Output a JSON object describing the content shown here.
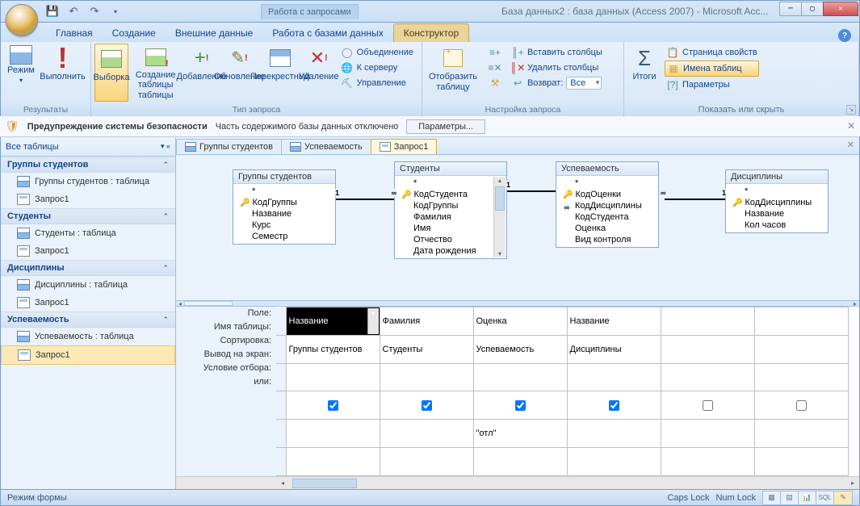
{
  "titlebar": {
    "context_tools": "Работа с запросами",
    "title": "База данных2 : база данных (Access 2007) - Microsoft Acc..."
  },
  "tabs": {
    "items": [
      "Главная",
      "Создание",
      "Внешние данные",
      "Работа с базами данных",
      "Конструктор"
    ],
    "active_index": 4
  },
  "ribbon": {
    "group_results": {
      "label": "Результаты",
      "mode": "Режим",
      "run": "Выполнить"
    },
    "group_querytype": {
      "label": "Тип запроса",
      "select": "Выборка",
      "maketable": "Создание таблицы",
      "append": "Добавление",
      "update": "Обновление",
      "crosstab": "Перекрестный",
      "delete": "Удаление",
      "union": "Объединение",
      "passthrough": "К серверу",
      "datadef": "Управление"
    },
    "group_querysetup": {
      "label": "Настройка запроса",
      "showtable": "Отобразить таблицу",
      "insert_cols": "Вставить столбцы",
      "delete_cols": "Удалить столбцы",
      "return_label": "Возврат:",
      "return_value": "Все"
    },
    "group_showhide": {
      "label": "Показать или скрыть",
      "totals": "Итоги",
      "prop_sheet": "Страница свойств",
      "table_names": "Имена таблиц",
      "parameters": "Параметры"
    }
  },
  "security": {
    "title": "Предупреждение системы безопасности",
    "msg": "Часть содержимого базы данных отключено",
    "btn": "Параметры..."
  },
  "nav": {
    "header": "Все таблицы",
    "groups": [
      {
        "title": "Группы студентов",
        "items": [
          {
            "type": "table",
            "label": "Группы студентов : таблица"
          },
          {
            "type": "query",
            "label": "Запрос1"
          }
        ]
      },
      {
        "title": "Студенты",
        "items": [
          {
            "type": "table",
            "label": "Студенты : таблица"
          },
          {
            "type": "query",
            "label": "Запрос1"
          }
        ]
      },
      {
        "title": "Дисциплины",
        "items": [
          {
            "type": "table",
            "label": "Дисциплины : таблица"
          },
          {
            "type": "query",
            "label": "Запрос1"
          }
        ]
      },
      {
        "title": "Успеваемость",
        "items": [
          {
            "type": "table",
            "label": "Успеваемость : таблица"
          },
          {
            "type": "query",
            "label": "Запрос1",
            "selected": true
          }
        ]
      }
    ]
  },
  "doc_tabs": [
    "Группы студентов",
    "Успеваемость",
    "Запрос1"
  ],
  "doc_tab_active": 2,
  "designer_tables": {
    "t1": {
      "title": "Группы студентов",
      "fields": [
        "*",
        "КодГруппы",
        "Название",
        "Курс",
        "Семестр"
      ],
      "key_index": 1
    },
    "t2": {
      "title": "Студенты",
      "fields": [
        "*",
        "КодСтудента",
        "КодГруппы",
        "Фамилия",
        "Имя",
        "Отчество",
        "Дата рождения"
      ],
      "key_index": 1
    },
    "t3": {
      "title": "Успеваемость",
      "fields": [
        "*",
        "КодОценки",
        "КодДисциплины",
        "КодСтудента",
        "Оценка",
        "Вид контроля"
      ],
      "key_index": 1
    },
    "t4": {
      "title": "Дисциплины",
      "fields": [
        "*",
        "КодДисциплины",
        "Название",
        "Кол часов"
      ],
      "key_index": 1
    }
  },
  "grid": {
    "row_labels": [
      "Поле:",
      "Имя таблицы:",
      "Сортировка:",
      "Вывод на экран:",
      "Условие отбора:",
      "или:"
    ],
    "cols": [
      {
        "field": "Название",
        "table": "Группы студентов",
        "show": true,
        "criteria": "",
        "active_dd": true
      },
      {
        "field": "Фамилия",
        "table": "Студенты",
        "show": true,
        "criteria": ""
      },
      {
        "field": "Оценка",
        "table": "Успеваемость",
        "show": true,
        "criteria": "\"отл\""
      },
      {
        "field": "Название",
        "table": "Дисциплины",
        "show": true,
        "criteria": ""
      },
      {
        "field": "",
        "table": "",
        "show": false,
        "criteria": ""
      },
      {
        "field": "",
        "table": "",
        "show": false,
        "criteria": ""
      }
    ]
  },
  "status": {
    "mode": "Режим формы",
    "caps": "Caps Lock",
    "num": "Num Lock"
  }
}
